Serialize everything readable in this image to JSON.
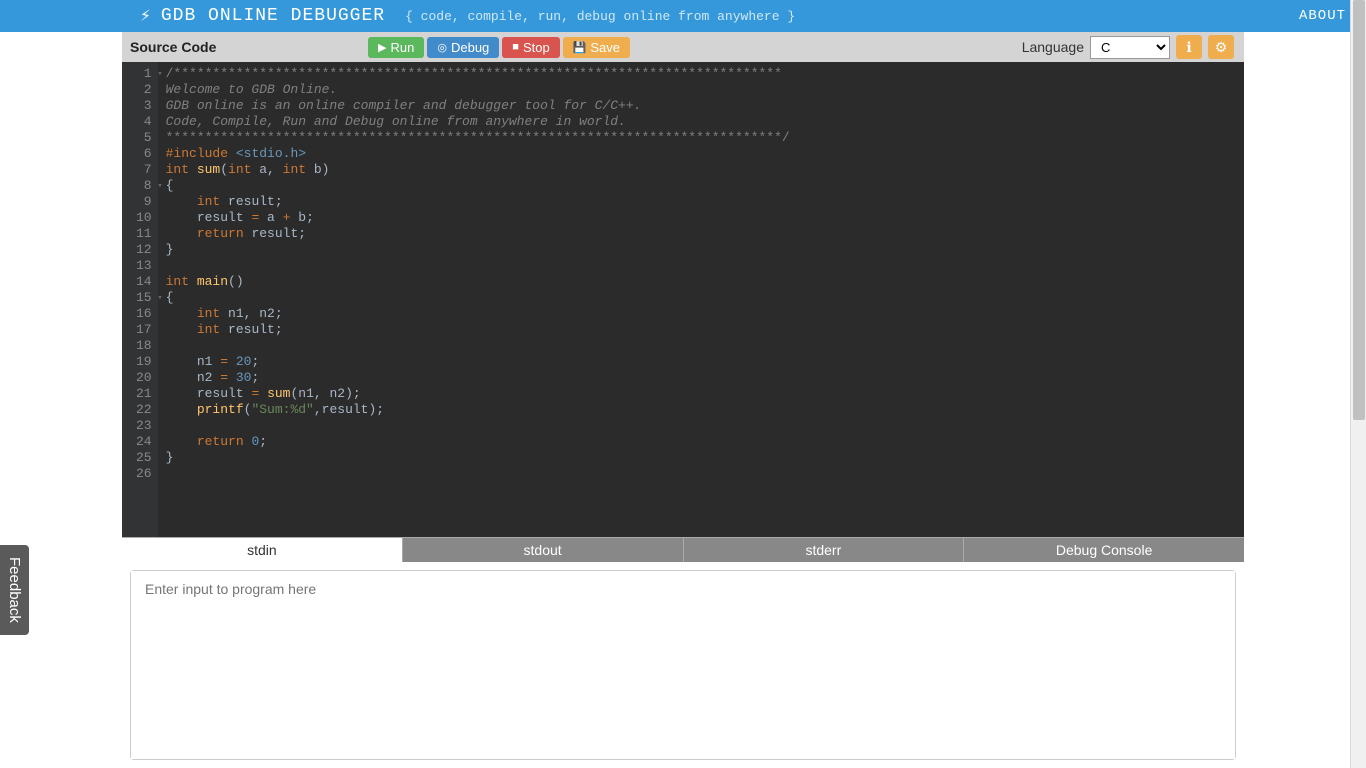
{
  "header": {
    "title": "GDB ONLINE DEBUGGER",
    "tagline": "{ code, compile, run, debug online from anywhere }",
    "about": "ABOUT"
  },
  "toolbar": {
    "source_label": "Source Code",
    "run": "Run",
    "debug": "Debug",
    "stop": "Stop",
    "save": "Save",
    "language_label": "Language",
    "language_selected": "C"
  },
  "code_lines": [
    {
      "n": 1,
      "fold": true,
      "html": "<span class='cm-star'>/******************************************************************************</span>"
    },
    {
      "n": 2,
      "html": "<span class='cm'>Welcome to GDB Online.</span>"
    },
    {
      "n": 3,
      "html": "<span class='cm'>GDB online is an online compiler and debugger tool for C/C++.</span>"
    },
    {
      "n": 4,
      "html": "<span class='cm'>Code, Compile, Run and Debug online from anywhere in world.</span>"
    },
    {
      "n": 5,
      "html": "<span class='cm-star'>*******************************************************************************/</span>"
    },
    {
      "n": 6,
      "html": "<span class='pp'>#include</span> <span class='inc'>&lt;stdio.h&gt;</span>"
    },
    {
      "n": 7,
      "html": "<span class='ty'>int</span> <span class='fn'>sum</span>(<span class='ty'>int</span> a, <span class='ty'>int</span> b)"
    },
    {
      "n": 8,
      "fold": true,
      "html": "{"
    },
    {
      "n": 9,
      "html": "    <span class='ty'>int</span> result;"
    },
    {
      "n": 10,
      "html": "    result <span class='eq'>=</span> a <span class='eq'>+</span> b;"
    },
    {
      "n": 11,
      "html": "    <span class='kw'>return</span> result;"
    },
    {
      "n": 12,
      "html": "}"
    },
    {
      "n": 13,
      "html": ""
    },
    {
      "n": 14,
      "html": "<span class='ty'>int</span> <span class='fn'>main</span>()"
    },
    {
      "n": 15,
      "fold": true,
      "html": "{"
    },
    {
      "n": 16,
      "html": "    <span class='ty'>int</span> n1, n2;"
    },
    {
      "n": 17,
      "html": "    <span class='ty'>int</span> result;"
    },
    {
      "n": 18,
      "html": ""
    },
    {
      "n": 19,
      "html": "    n1 <span class='eq'>=</span> <span class='num'>20</span>;"
    },
    {
      "n": 20,
      "html": "    n2 <span class='eq'>=</span> <span class='num'>30</span>;"
    },
    {
      "n": 21,
      "html": "    result <span class='eq'>=</span> <span class='fn'>sum</span>(n1, n2);"
    },
    {
      "n": 22,
      "html": "    <span class='fn'>printf</span>(<span class='str'>\"Sum:%d\"</span>,result);"
    },
    {
      "n": 23,
      "html": ""
    },
    {
      "n": 24,
      "html": "    <span class='kw'>return</span> <span class='num'>0</span>;"
    },
    {
      "n": 25,
      "html": "}"
    },
    {
      "n": 26,
      "html": ""
    }
  ],
  "tabs": {
    "stdin": "stdin",
    "stdout": "stdout",
    "stderr": "stderr",
    "debug": "Debug Console"
  },
  "io": {
    "placeholder": "Enter input to program here"
  },
  "feedback": "Feedback"
}
